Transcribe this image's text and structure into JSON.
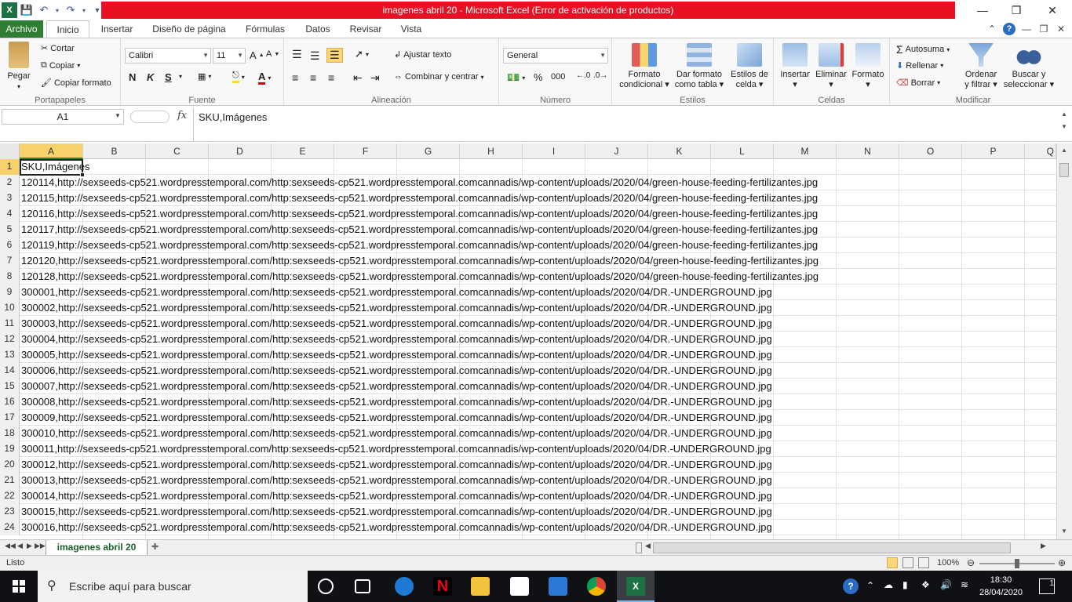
{
  "window": {
    "title": "imagenes abril 20  -  Microsoft Excel (Error de activación de productos)"
  },
  "ribbon_tabs": [
    {
      "label": "Archivo"
    },
    {
      "label": "Inicio"
    },
    {
      "label": "Insertar"
    },
    {
      "label": "Diseño de página"
    },
    {
      "label": "Fórmulas"
    },
    {
      "label": "Datos"
    },
    {
      "label": "Revisar"
    },
    {
      "label": "Vista"
    }
  ],
  "clipboard": {
    "paste": "Pegar",
    "cut": "Cortar",
    "copy": "Copiar",
    "format_painter": "Copiar formato",
    "group_label": "Portapapeles"
  },
  "font": {
    "family": "Calibri",
    "size": "11",
    "bold": "N",
    "italic": "K",
    "underline": "S",
    "group_label": "Fuente"
  },
  "alignment": {
    "wrap": "Ajustar texto",
    "merge": "Combinar y centrar",
    "group_label": "Alineación"
  },
  "number": {
    "format": "General",
    "percent": "%",
    "thousands": "000",
    "group_label": "Número"
  },
  "styles": {
    "conditional": [
      "Formato",
      "condicional"
    ],
    "as_table": [
      "Dar formato",
      "como tabla"
    ],
    "cell_styles": [
      "Estilos de",
      "celda"
    ],
    "group_label": "Estilos"
  },
  "cells_group": {
    "insert": "Insertar",
    "delete": "Eliminar",
    "format": "Formato",
    "group_label": "Celdas"
  },
  "editing": {
    "autosum": "Autosuma",
    "fill": "Rellenar",
    "clear": "Borrar",
    "sort": [
      "Ordenar",
      "y filtrar"
    ],
    "find": [
      "Buscar y",
      "seleccionar"
    ],
    "group_label": "Modificar"
  },
  "formula_bar": {
    "name_box": "A1",
    "fx": "fx",
    "content": "SKU,Imágenes"
  },
  "columns": [
    "A",
    "B",
    "C",
    "D",
    "E",
    "F",
    "G",
    "H",
    "I",
    "J",
    "K",
    "L",
    "M",
    "N",
    "O",
    "P",
    "Q"
  ],
  "rows": [
    {
      "num": "1",
      "text": "SKU,Imágenes"
    },
    {
      "num": "2",
      "text": "120114,http://sexseeds-cp521.wordpresstemporal.com/http:sexseeds-cp521.wordpresstemporal.comcannadis/wp-content/uploads/2020/04/green-house-feeding-fertilizantes.jpg"
    },
    {
      "num": "3",
      "text": "120115,http://sexseeds-cp521.wordpresstemporal.com/http:sexseeds-cp521.wordpresstemporal.comcannadis/wp-content/uploads/2020/04/green-house-feeding-fertilizantes.jpg"
    },
    {
      "num": "4",
      "text": "120116,http://sexseeds-cp521.wordpresstemporal.com/http:sexseeds-cp521.wordpresstemporal.comcannadis/wp-content/uploads/2020/04/green-house-feeding-fertilizantes.jpg"
    },
    {
      "num": "5",
      "text": "120117,http://sexseeds-cp521.wordpresstemporal.com/http:sexseeds-cp521.wordpresstemporal.comcannadis/wp-content/uploads/2020/04/green-house-feeding-fertilizantes.jpg"
    },
    {
      "num": "6",
      "text": "120119,http://sexseeds-cp521.wordpresstemporal.com/http:sexseeds-cp521.wordpresstemporal.comcannadis/wp-content/uploads/2020/04/green-house-feeding-fertilizantes.jpg"
    },
    {
      "num": "7",
      "text": "120120,http://sexseeds-cp521.wordpresstemporal.com/http:sexseeds-cp521.wordpresstemporal.comcannadis/wp-content/uploads/2020/04/green-house-feeding-fertilizantes.jpg"
    },
    {
      "num": "8",
      "text": "120128,http://sexseeds-cp521.wordpresstemporal.com/http:sexseeds-cp521.wordpresstemporal.comcannadis/wp-content/uploads/2020/04/green-house-feeding-fertilizantes.jpg"
    },
    {
      "num": "9",
      "text": "300001,http://sexseeds-cp521.wordpresstemporal.com/http:sexseeds-cp521.wordpresstemporal.comcannadis/wp-content/uploads/2020/04/DR.-UNDERGROUND.jpg"
    },
    {
      "num": "10",
      "text": "300002,http://sexseeds-cp521.wordpresstemporal.com/http:sexseeds-cp521.wordpresstemporal.comcannadis/wp-content/uploads/2020/04/DR.-UNDERGROUND.jpg"
    },
    {
      "num": "11",
      "text": "300003,http://sexseeds-cp521.wordpresstemporal.com/http:sexseeds-cp521.wordpresstemporal.comcannadis/wp-content/uploads/2020/04/DR.-UNDERGROUND.jpg"
    },
    {
      "num": "12",
      "text": "300004,http://sexseeds-cp521.wordpresstemporal.com/http:sexseeds-cp521.wordpresstemporal.comcannadis/wp-content/uploads/2020/04/DR.-UNDERGROUND.jpg"
    },
    {
      "num": "13",
      "text": "300005,http://sexseeds-cp521.wordpresstemporal.com/http:sexseeds-cp521.wordpresstemporal.comcannadis/wp-content/uploads/2020/04/DR.-UNDERGROUND.jpg"
    },
    {
      "num": "14",
      "text": "300006,http://sexseeds-cp521.wordpresstemporal.com/http:sexseeds-cp521.wordpresstemporal.comcannadis/wp-content/uploads/2020/04/DR.-UNDERGROUND.jpg"
    },
    {
      "num": "15",
      "text": "300007,http://sexseeds-cp521.wordpresstemporal.com/http:sexseeds-cp521.wordpresstemporal.comcannadis/wp-content/uploads/2020/04/DR.-UNDERGROUND.jpg"
    },
    {
      "num": "16",
      "text": "300008,http://sexseeds-cp521.wordpresstemporal.com/http:sexseeds-cp521.wordpresstemporal.comcannadis/wp-content/uploads/2020/04/DR.-UNDERGROUND.jpg"
    },
    {
      "num": "17",
      "text": "300009,http://sexseeds-cp521.wordpresstemporal.com/http:sexseeds-cp521.wordpresstemporal.comcannadis/wp-content/uploads/2020/04/DR.-UNDERGROUND.jpg"
    },
    {
      "num": "18",
      "text": "300010,http://sexseeds-cp521.wordpresstemporal.com/http:sexseeds-cp521.wordpresstemporal.comcannadis/wp-content/uploads/2020/04/DR.-UNDERGROUND.jpg"
    },
    {
      "num": "19",
      "text": "300011,http://sexseeds-cp521.wordpresstemporal.com/http:sexseeds-cp521.wordpresstemporal.comcannadis/wp-content/uploads/2020/04/DR.-UNDERGROUND.jpg"
    },
    {
      "num": "20",
      "text": "300012,http://sexseeds-cp521.wordpresstemporal.com/http:sexseeds-cp521.wordpresstemporal.comcannadis/wp-content/uploads/2020/04/DR.-UNDERGROUND.jpg"
    },
    {
      "num": "21",
      "text": "300013,http://sexseeds-cp521.wordpresstemporal.com/http:sexseeds-cp521.wordpresstemporal.comcannadis/wp-content/uploads/2020/04/DR.-UNDERGROUND.jpg"
    },
    {
      "num": "22",
      "text": "300014,http://sexseeds-cp521.wordpresstemporal.com/http:sexseeds-cp521.wordpresstemporal.comcannadis/wp-content/uploads/2020/04/DR.-UNDERGROUND.jpg"
    },
    {
      "num": "23",
      "text": "300015,http://sexseeds-cp521.wordpresstemporal.com/http:sexseeds-cp521.wordpresstemporal.comcannadis/wp-content/uploads/2020/04/DR.-UNDERGROUND.jpg"
    },
    {
      "num": "24",
      "text": "300016,http://sexseeds-cp521.wordpresstemporal.com/http:sexseeds-cp521.wordpresstemporal.comcannadis/wp-content/uploads/2020/04/DR.-UNDERGROUND.jpg"
    }
  ],
  "sheet_tab": "imagenes abril 20",
  "status": {
    "mode": "Listo",
    "zoom": "100%"
  },
  "taskbar": {
    "search_placeholder": "Escribe aquí para buscar",
    "time": "18:30",
    "date": "28/04/2020",
    "notifications": "1"
  },
  "colors": {
    "title_error": "#e81123",
    "file_tab": "#2e7d32",
    "active_header": "#f7d26a"
  }
}
